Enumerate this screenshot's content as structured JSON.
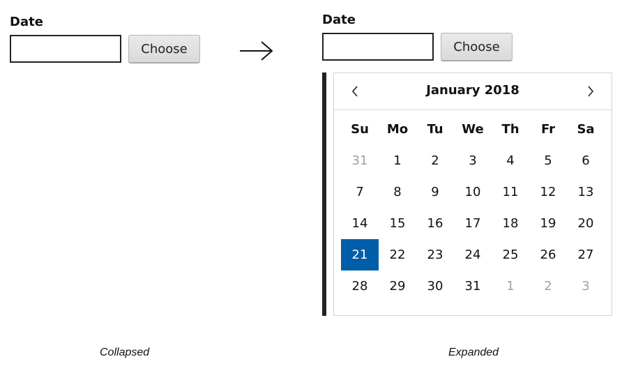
{
  "collapsed": {
    "label": "Date",
    "input_value": "",
    "button_label": "Choose",
    "caption": "Collapsed"
  },
  "expanded": {
    "label": "Date",
    "input_value": "",
    "button_label": "Choose",
    "caption": "Expanded",
    "calendar": {
      "month_title": "January 2018",
      "prev_icon": "chevron-left-icon",
      "next_icon": "chevron-right-icon",
      "weekdays": [
        "Su",
        "Mo",
        "Tu",
        "We",
        "Th",
        "Fr",
        "Sa"
      ],
      "weeks": [
        [
          {
            "d": "31",
            "m": true
          },
          {
            "d": "1"
          },
          {
            "d": "2"
          },
          {
            "d": "3"
          },
          {
            "d": "4"
          },
          {
            "d": "5"
          },
          {
            "d": "6"
          }
        ],
        [
          {
            "d": "7"
          },
          {
            "d": "8"
          },
          {
            "d": "9"
          },
          {
            "d": "10"
          },
          {
            "d": "11"
          },
          {
            "d": "12"
          },
          {
            "d": "13"
          }
        ],
        [
          {
            "d": "14"
          },
          {
            "d": "15"
          },
          {
            "d": "16"
          },
          {
            "d": "17"
          },
          {
            "d": "18"
          },
          {
            "d": "19"
          },
          {
            "d": "20"
          }
        ],
        [
          {
            "d": "21",
            "s": true
          },
          {
            "d": "22"
          },
          {
            "d": "23"
          },
          {
            "d": "24"
          },
          {
            "d": "25"
          },
          {
            "d": "26"
          },
          {
            "d": "27"
          }
        ],
        [
          {
            "d": "28"
          },
          {
            "d": "29"
          },
          {
            "d": "30"
          },
          {
            "d": "31"
          },
          {
            "d": "1",
            "m": true
          },
          {
            "d": "2",
            "m": true
          },
          {
            "d": "3",
            "m": true
          }
        ]
      ],
      "selected_color": "#005ea8",
      "muted_color": "#a2a2a2"
    }
  },
  "arrow_icon": "arrow-right-icon"
}
